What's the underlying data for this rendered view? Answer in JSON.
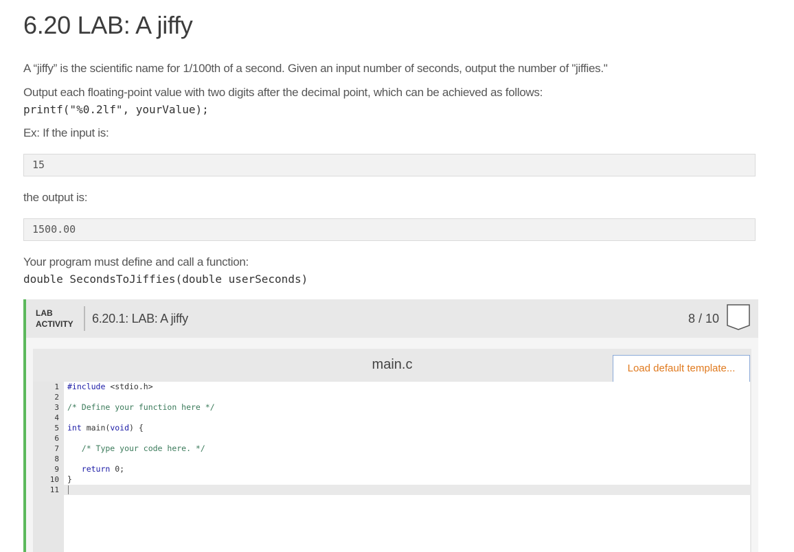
{
  "page": {
    "title": "6.20 LAB: A jiffy",
    "intro": "A “jiffy” is the scientific name for 1/100th of a second. Given an input number of seconds, output the number of \"jiffies.\"",
    "format_note": "Output each floating-point value with two digits after the decimal point, which can be achieved as follows:",
    "format_code": "printf(\"%0.2lf\", yourValue);",
    "example_intro": "Ex: If the input is:",
    "example_input": "15",
    "output_intro": "the output is:",
    "example_output": "1500.00",
    "function_note": "Your program must define and call a function:",
    "function_signature": "double SecondsToJiffies(double userSeconds)"
  },
  "lab": {
    "tag_line1": "LAB",
    "tag_line2": "ACTIVITY",
    "name": "6.20.1: LAB: A jiffy",
    "score": "8 / 10",
    "file_name": "main.c",
    "load_button": "Load default template...",
    "line_numbers": [
      "1",
      "2",
      "3",
      "4",
      "5",
      "6",
      "7",
      "8",
      "9",
      "10",
      "11"
    ],
    "code": {
      "l1_kw": "#include",
      "l1_rest": " <stdio.h>",
      "l3": "/* Define your function here */",
      "l5_kw": "int",
      "l5_mid": " main(",
      "l5_kw2": "void",
      "l5_end": ") {",
      "l7": "   /* Type your code here. */",
      "l9_kw": "   return",
      "l9_rest": " 0;",
      "l10": "}"
    }
  },
  "colors": {
    "accent_green": "#5cb85c",
    "load_button_text": "#e07a1f",
    "load_button_border": "#8aa9d8"
  }
}
